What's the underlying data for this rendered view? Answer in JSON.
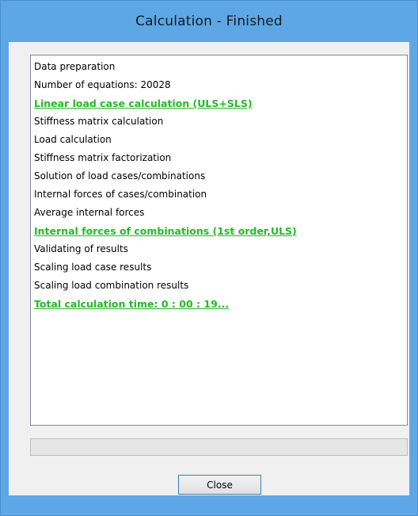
{
  "window": {
    "title": "Calculation - Finished"
  },
  "log": {
    "lines": [
      {
        "text": "Data preparation",
        "highlight": false
      },
      {
        "text": "Number of equations: 20028",
        "highlight": false
      },
      {
        "text": "Linear load case calculation (ULS+SLS)",
        "highlight": true
      },
      {
        "text": "Stiffness matrix calculation",
        "highlight": false
      },
      {
        "text": "Load calculation",
        "highlight": false
      },
      {
        "text": "Stiffness matrix factorization",
        "highlight": false
      },
      {
        "text": "Solution of load cases/combinations",
        "highlight": false
      },
      {
        "text": "Internal forces of cases/combination",
        "highlight": false
      },
      {
        "text": "Average internal forces",
        "highlight": false
      },
      {
        "text": "Internal forces of combinations (1st order,ULS)",
        "highlight": true
      },
      {
        "text": "Validating of results",
        "highlight": false
      },
      {
        "text": "Scaling load case results",
        "highlight": false
      },
      {
        "text": "Scaling load combination results",
        "highlight": false
      },
      {
        "text": "Total calculation time:  0 : 00 : 19...",
        "highlight": true
      }
    ]
  },
  "progress": {
    "fraction": 0
  },
  "buttons": {
    "close_label": "Close"
  },
  "colors": {
    "titlebar": "#5da7e6",
    "highlight_text": "#22bb22",
    "panel_background": "#f0f0f0"
  }
}
